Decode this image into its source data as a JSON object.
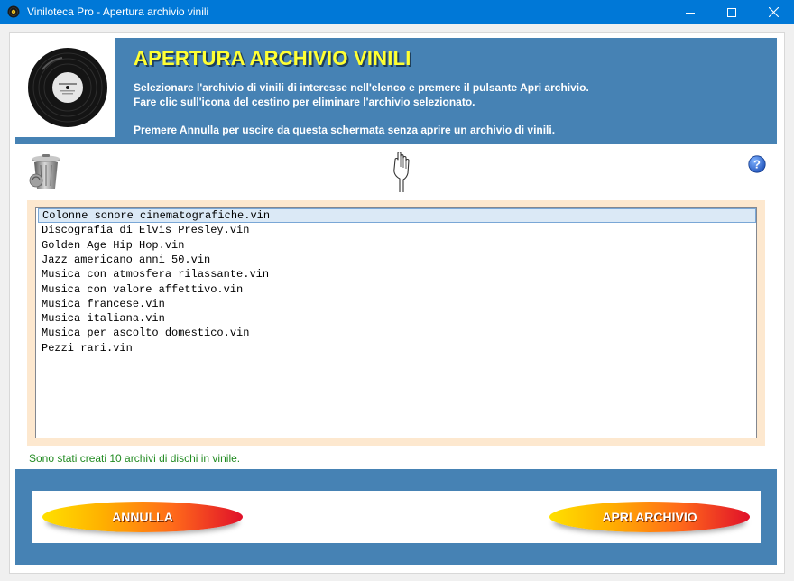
{
  "window": {
    "title": "Viniloteca Pro - Apertura archivio vinili"
  },
  "header": {
    "title": "APERTURA ARCHIVIO VINILI",
    "line1": "Selezionare l'archivio di vinili di interesse nell'elenco e premere il pulsante Apri archivio.",
    "line2": "Fare clic sull'icona del cestino per eliminare l'archivio selezionato.",
    "line3": "Premere Annulla per uscire da questa schermata senza aprire un archivio di vinili."
  },
  "files": [
    "Colonne sonore cinematografiche.vin",
    "Discografia di Elvis Presley.vin",
    "Golden Age Hip Hop.vin",
    "Jazz americano anni 50.vin",
    "Musica con atmosfera rilassante.vin",
    "Musica con valore affettivo.vin",
    "Musica francese.vin",
    "Musica italiana.vin",
    "Musica per ascolto domestico.vin",
    "Pezzi rari.vin"
  ],
  "status": "Sono stati creati 10 archivi di dischi in vinile.",
  "buttons": {
    "cancel": "ANNULLA",
    "open": "APRI ARCHIVIO"
  },
  "colors": {
    "titlebar": "#0078d7",
    "panel": "#4682b4",
    "title_text": "#ffff33",
    "list_background": "#fde8cf",
    "status_text": "#228b22"
  },
  "icons": {
    "app": "vinyl-record-icon",
    "logo": "vinyl-record-logo",
    "delete": "trash-can-icon",
    "pointer": "pointing-hand-icon",
    "help": "help-question-icon"
  }
}
